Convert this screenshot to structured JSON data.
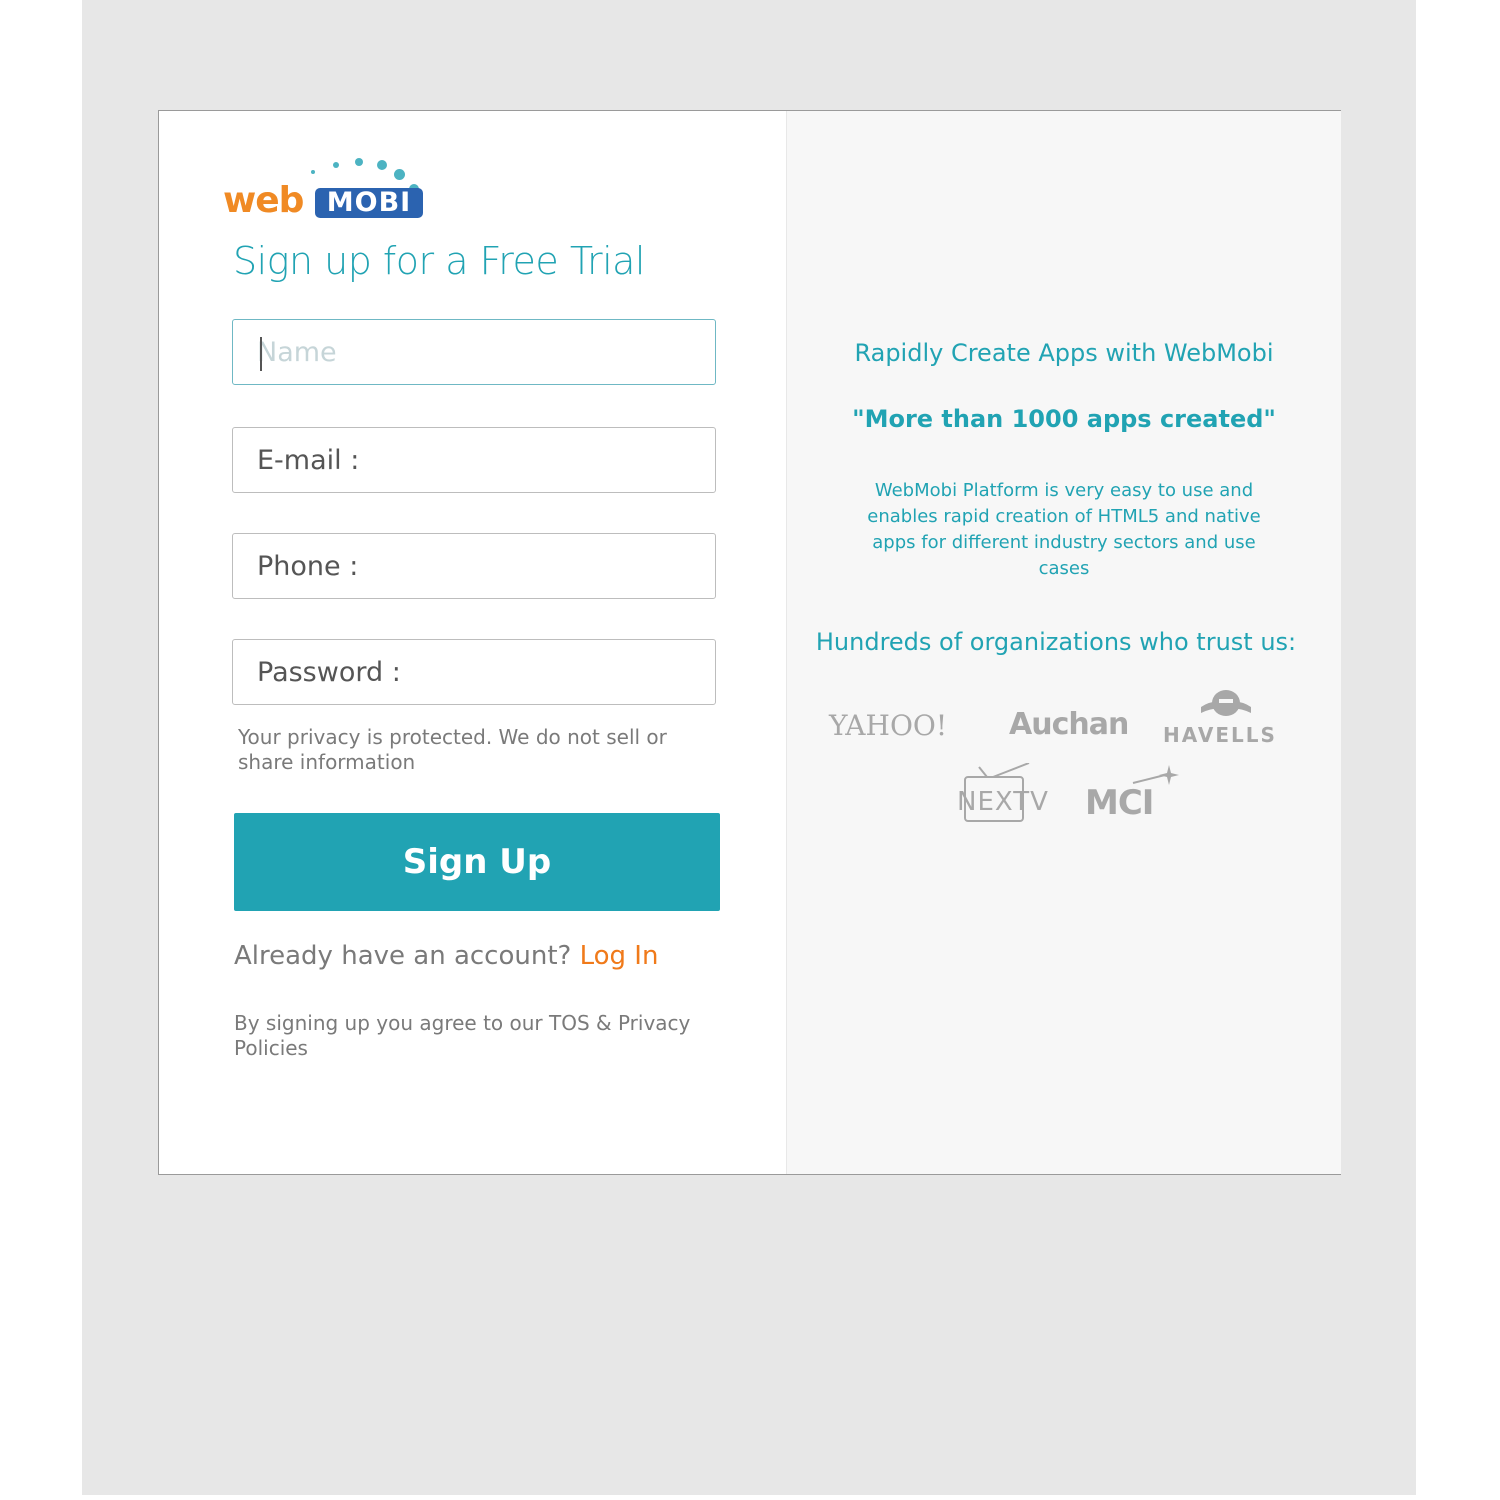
{
  "logo": {
    "web": "web",
    "mobi": "MOBI"
  },
  "form": {
    "title": "Sign up for a Free Trial",
    "name_placeholder": "Name",
    "email_placeholder": "E-mail :",
    "phone_placeholder": "Phone :",
    "password_placeholder": "Password :",
    "privacy_text": "Your privacy is protected. We do not sell or share information",
    "signup_label": "Sign Up",
    "account_prompt": "Already have an account?",
    "login_label": "Log In",
    "tos_text": "By signing up you agree to our TOS & Privacy Policies"
  },
  "promo": {
    "headline": "Rapidly Create Apps with WebMobi",
    "quote": "\"More than 1000 apps created\"",
    "description": "WebMobi Platform is very easy to use and enables rapid creation of HTML5 and native apps for different industry sectors and use cases",
    "trust_heading": "Hundreds of organizations who trust us:",
    "brands": [
      "YAHOO!",
      "Auchan",
      "HAVELLS",
      "NEXTV",
      "MCI"
    ]
  },
  "colors": {
    "accent": "#21a3b3",
    "login_link": "#f07a1a",
    "logo_orange": "#f08a24",
    "logo_blue": "#2b63b0",
    "page_bg": "#e7e7e7"
  }
}
